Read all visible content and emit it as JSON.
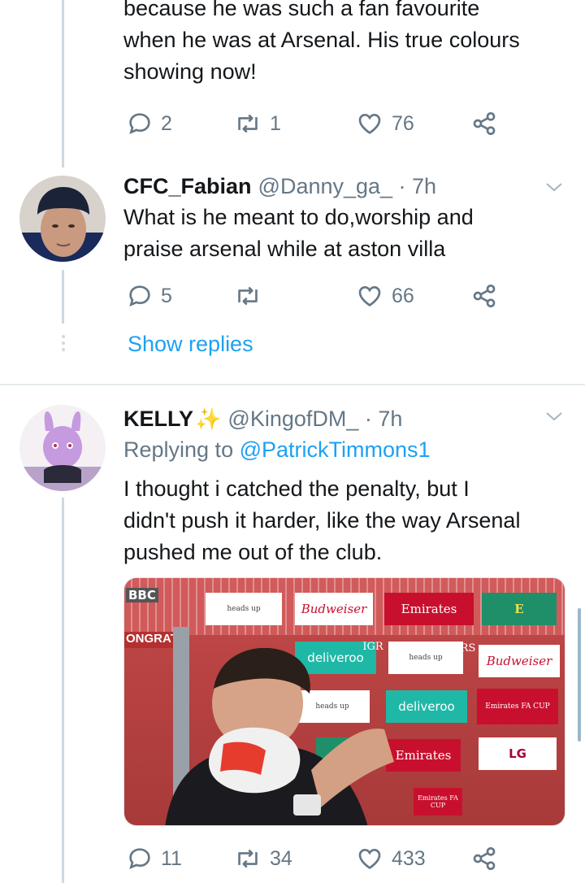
{
  "tweet1": {
    "text_lines": [
      "because he was such a fan favourite",
      "when he was at Arsenal. His true colours",
      "showing now!"
    ],
    "actions": {
      "replies": "2",
      "retweets": "1",
      "likes": "76"
    }
  },
  "tweet2": {
    "display_name": "CFC_Fabian",
    "handle_time": "@Danny_ga_ · 7h",
    "text_lines": [
      "What is he meant to do,worship and",
      "praise arsenal while at aston villa"
    ],
    "actions": {
      "replies": "5",
      "retweets": "",
      "likes": "66"
    }
  },
  "show_replies": "Show replies",
  "tweet3": {
    "display_name": "KELLY",
    "handle_time": "@KingofDM_ · 7h",
    "replying_prefix": "Replying to",
    "replying_to": "@PatrickTimmons1",
    "text_lines": [
      "I thought i catched the penalty, but I",
      "didn't push it harder, like the way Arsenal",
      "pushed me out of the club."
    ],
    "media_text": {
      "broadcaster": "BBC",
      "banner": "ONGRATU",
      "boards": [
        "Budweiser",
        "Emirates",
        "deliveroo",
        "Budweiser",
        "deliveroo",
        "Emirates",
        "LG",
        "Emirates FA CUP",
        "Emirates FA CUP",
        "IGR",
        "RS"
      ]
    },
    "actions": {
      "replies": "11",
      "retweets": "34",
      "likes": "433"
    }
  },
  "colors": {
    "link": "#1da1f2",
    "muted": "#657786",
    "text": "#14171a",
    "thread_line": "#cfd9de"
  }
}
